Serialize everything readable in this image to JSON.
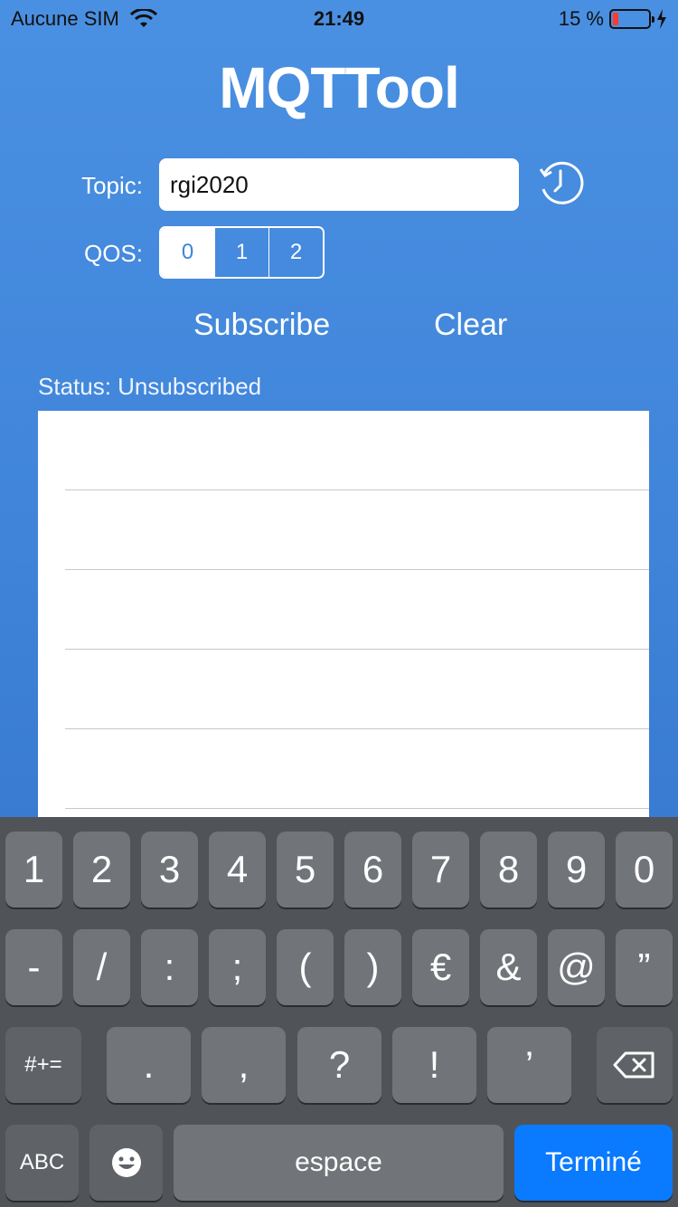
{
  "status_bar": {
    "carrier": "Aucune SIM",
    "time": "21:49",
    "battery_percent": "15 %",
    "battery_level": 0.15
  },
  "app": {
    "title": "MQTTool"
  },
  "form": {
    "topic_label": "Topic:",
    "topic_value": "rgi2020",
    "qos_label": "QOS:",
    "qos_options": [
      "0",
      "1",
      "2"
    ],
    "qos_selected": "0"
  },
  "actions": {
    "subscribe": "Subscribe",
    "clear": "Clear"
  },
  "status_text": "Status: Unsubscribed",
  "keyboard": {
    "row1": [
      "1",
      "2",
      "3",
      "4",
      "5",
      "6",
      "7",
      "8",
      "9",
      "0"
    ],
    "row2": [
      "-",
      "/",
      ":",
      ";",
      "(",
      ")",
      "€",
      "&",
      "@",
      "”"
    ],
    "row3": [
      "#+=",
      ".",
      ",",
      "?",
      "!",
      "’"
    ],
    "row4": {
      "abc": "ABC",
      "emoji": "emoji-icon",
      "space": "espace",
      "done": "Terminé"
    }
  },
  "colors": {
    "accent": "#4a90e2",
    "done_key": "#0a7aff",
    "battery_low": "#ff3b30"
  }
}
